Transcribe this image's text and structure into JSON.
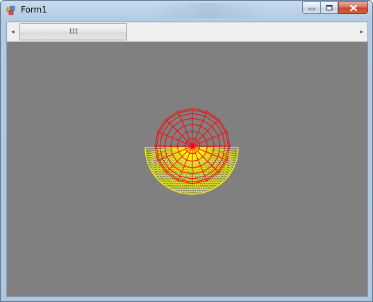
{
  "window": {
    "title": "Form1"
  },
  "caption_buttons": {
    "minimize_icon": "minimize-icon",
    "maximize_icon": "restore-icon",
    "close_icon": "close-icon"
  },
  "scrollbar": {
    "left_arrow": "◂",
    "right_arrow": "▸",
    "grip": "III",
    "position_fraction": 0.0,
    "thumb_fraction": 0.31
  },
  "scene": {
    "background": "#808080",
    "sphere_color": "#ff0000",
    "bowl_color": "#ffff00"
  }
}
